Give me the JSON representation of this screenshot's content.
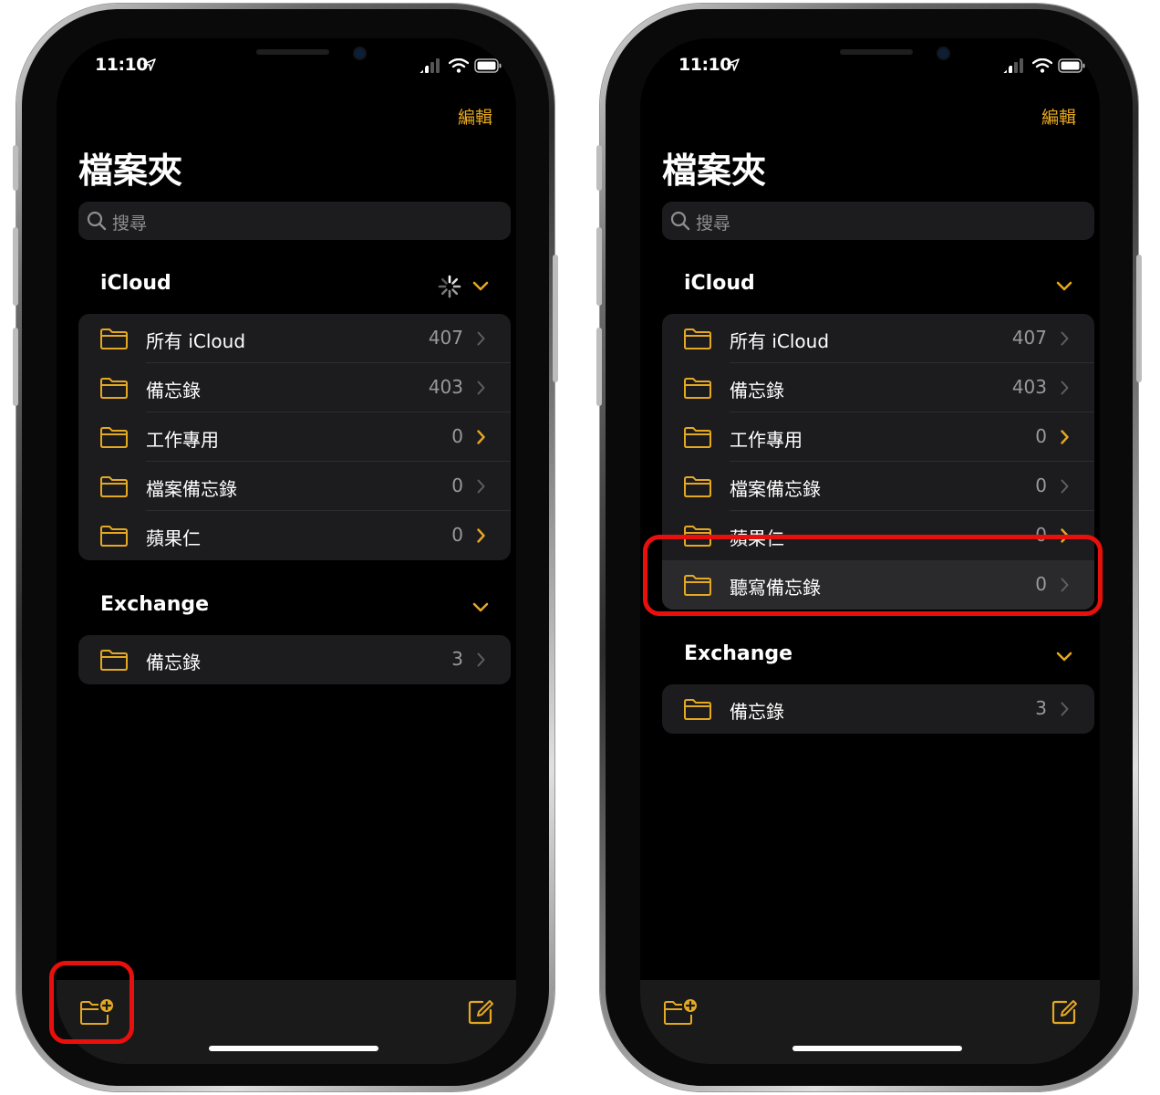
{
  "colors": {
    "accent": "#e5a822",
    "highlight_box": "#e8100d",
    "background": "#000000",
    "group_bg": "#1c1c1e"
  },
  "phones": [
    {
      "status_time": "11:10",
      "edit_label": "編輯",
      "title": "檔案夾",
      "search_placeholder": "搜尋",
      "icloud": {
        "header": "iCloud",
        "syncing": true,
        "items": [
          {
            "label": "所有 iCloud",
            "count": "407",
            "chevron_accent": false
          },
          {
            "label": "備忘錄",
            "count": "403",
            "chevron_accent": false
          },
          {
            "label": "工作專用",
            "count": "0",
            "chevron_accent": true
          },
          {
            "label": "檔案備忘錄",
            "count": "0",
            "chevron_accent": false
          },
          {
            "label": "蘋果仁",
            "count": "0",
            "chevron_accent": true
          }
        ]
      },
      "exchange": {
        "header": "Exchange",
        "items": [
          {
            "label": "備忘錄",
            "count": "3",
            "chevron_accent": false
          }
        ]
      },
      "toolbar": {
        "new_folder_icon": "folder-plus-icon",
        "compose_icon": "compose-icon"
      },
      "highlighted": "new-folder-button"
    },
    {
      "status_time": "11:10",
      "edit_label": "編輯",
      "title": "檔案夾",
      "search_placeholder": "搜尋",
      "icloud": {
        "header": "iCloud",
        "syncing": false,
        "items": [
          {
            "label": "所有 iCloud",
            "count": "407",
            "chevron_accent": false
          },
          {
            "label": "備忘錄",
            "count": "403",
            "chevron_accent": false
          },
          {
            "label": "工作專用",
            "count": "0",
            "chevron_accent": true
          },
          {
            "label": "檔案備忘錄",
            "count": "0",
            "chevron_accent": false
          },
          {
            "label": "蘋果仁",
            "count": "0",
            "chevron_accent": true
          },
          {
            "label": "聽寫備忘錄",
            "count": "0",
            "chevron_accent": false
          }
        ]
      },
      "exchange": {
        "header": "Exchange",
        "items": [
          {
            "label": "備忘錄",
            "count": "3",
            "chevron_accent": false
          }
        ]
      },
      "toolbar": {
        "new_folder_icon": "folder-plus-icon",
        "compose_icon": "compose-icon"
      },
      "highlighted": "new-folder-row"
    }
  ]
}
